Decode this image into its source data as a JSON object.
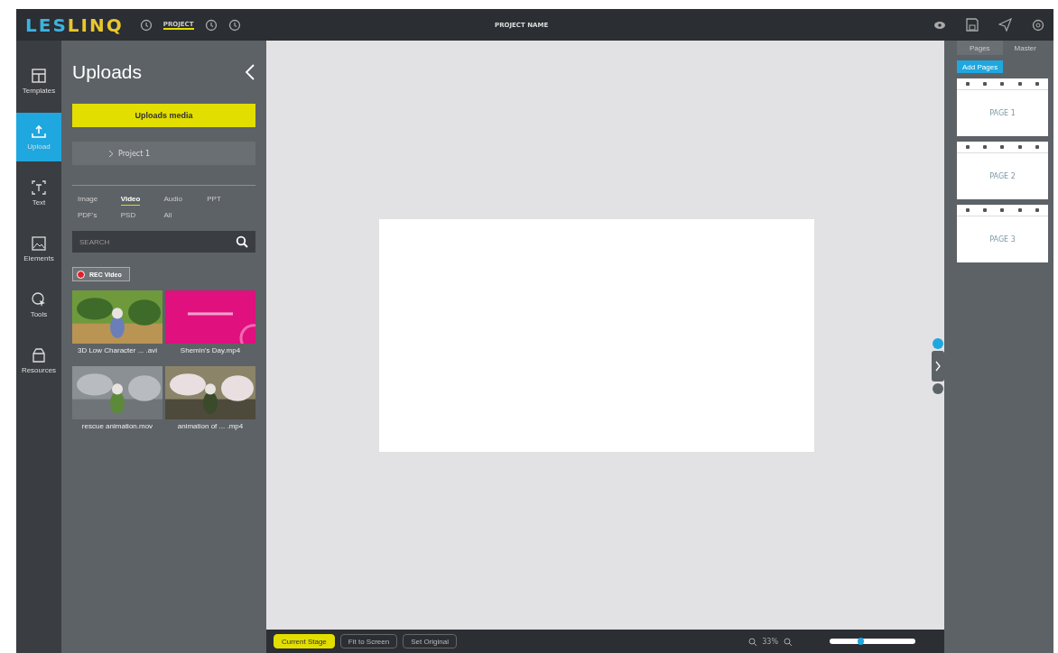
{
  "topbar": {
    "logo": [
      "LES",
      "LINQ"
    ],
    "nav": [
      {
        "kind": "icon"
      },
      {
        "kind": "link",
        "label": "PROJECT",
        "selected": true
      },
      {
        "kind": "icon"
      },
      {
        "kind": "icon"
      }
    ],
    "title": "PROJECT NAME"
  },
  "rail": [
    {
      "label": "Templates",
      "selected": false
    },
    {
      "label": "Upload",
      "selected": true
    },
    {
      "label": "Text",
      "selected": false
    },
    {
      "label": "Elements",
      "selected": false
    },
    {
      "label": "Tools",
      "selected": false
    },
    {
      "label": "Resources",
      "selected": false
    }
  ],
  "panel": {
    "title": "Uploads",
    "upload_button": "Uploads media",
    "folder": "Project 1",
    "filters": [
      {
        "label": "Image",
        "selected": false
      },
      {
        "label": "Video",
        "selected": true
      },
      {
        "label": "Audio",
        "selected": false
      },
      {
        "label": "PPT",
        "selected": false
      },
      {
        "label": "PDF's",
        "selected": false
      },
      {
        "label": "PSD",
        "selected": false
      },
      {
        "label": "All",
        "selected": false
      }
    ],
    "search": {
      "placeholder": "SEARCH"
    },
    "rec_button": "REC Video",
    "media": [
      {
        "name": "3D Low Character ... .avi"
      },
      {
        "name": "Shemin's Day.mp4"
      },
      {
        "name": "rescue animation.mov"
      },
      {
        "name": "animation of ... .mp4"
      }
    ]
  },
  "right_panel": {
    "tabs": [
      {
        "label": "Pages",
        "selected": true
      },
      {
        "label": "Master",
        "selected": false
      }
    ],
    "add_button": "Add Pages",
    "pages": [
      "PAGE 1",
      "PAGE 2",
      "PAGE 3"
    ]
  },
  "bottombar": {
    "buttons": [
      {
        "label": "Current Stage",
        "primary": true
      },
      {
        "label": "Fit to Screen",
        "primary": false
      },
      {
        "label": "Set Original",
        "primary": false
      }
    ],
    "zoom": "33%",
    "zoom_slider": {
      "level": 0.36
    }
  }
}
